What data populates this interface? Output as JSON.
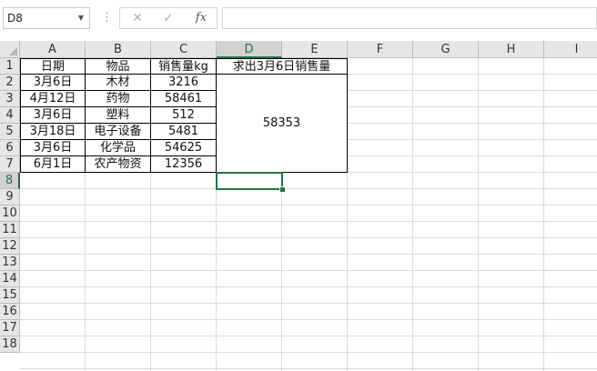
{
  "name_box": "D8",
  "formula_bar": {
    "cancel_icon": "✕",
    "enter_icon": "✓",
    "fx_label": "fx",
    "formula": ""
  },
  "columns": [
    "A",
    "B",
    "C",
    "D",
    "E",
    "F",
    "G",
    "H",
    "I"
  ],
  "rows": [
    "1",
    "2",
    "3",
    "4",
    "5",
    "6",
    "7",
    "8",
    "9",
    "10",
    "11",
    "12",
    "13",
    "14",
    "15",
    "16",
    "17",
    "18"
  ],
  "table": {
    "headers": [
      "日期",
      "物品",
      "销售量kg"
    ],
    "rows": [
      [
        "3月6日",
        "木材",
        "3216"
      ],
      [
        "4月12日",
        "药物",
        "58461"
      ],
      [
        "3月6日",
        "塑料",
        "512"
      ],
      [
        "3月18日",
        "电子设备",
        "5481"
      ],
      [
        "3月6日",
        "化学品",
        "54625"
      ],
      [
        "6月1日",
        "农产物资",
        "12356"
      ]
    ]
  },
  "question_label": "求出3月6日销售量",
  "result_value": "58353",
  "colors": {
    "accent": "#217346",
    "header_bg": "#e6e6e6",
    "gridline": "#dadada"
  }
}
